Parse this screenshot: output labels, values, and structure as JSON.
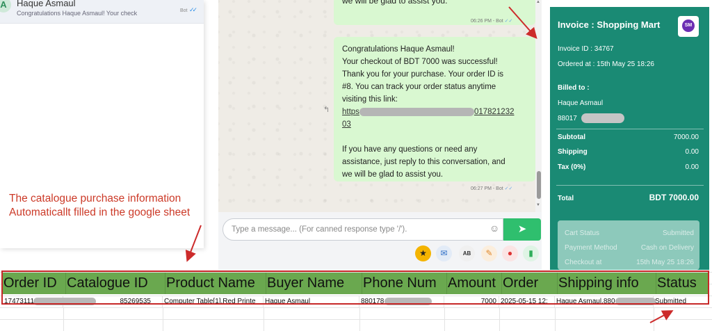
{
  "contact_list": {
    "avatar_initial": "A",
    "name": "Haque Asmaul",
    "preview": "Congratulations Haque Asmaul! Your check",
    "tag": "Bot",
    "ticks": "✓✓"
  },
  "chat": {
    "top_bubble_text": "we will be glad to assist you.",
    "top_bubble_time": "06:26 PM - Bot",
    "main_bubble": {
      "line1": "Congratulations Haque Asmaul!",
      "line2": "Your checkout of BDT 7000 was successful!",
      "line3": "Thank you for your purchase. Your order ID is",
      "line4": "#8. You can track your order status anytime",
      "line5": "visiting this link:",
      "link_start": "https",
      "link_end": "017821232",
      "link_wrap": "03",
      "line6": "If you have any questions or need any",
      "line7": "assistance, just reply to this conversation, and",
      "line8": "we will be glad to assist you."
    },
    "main_bubble_time": "06:27 PM - Bot",
    "composer_placeholder": "Type a message... (For canned response type '/').",
    "toolbar_icons": [
      "star-icon",
      "inbox-icon",
      "spellcheck-icon",
      "attachment-icon",
      "location-icon",
      "microphone-icon"
    ]
  },
  "invoice": {
    "title": "Invoice : Shopping Mart",
    "invoice_id": "Invoice ID : 34767",
    "ordered_at": "Ordered at : 15th May 25 18:26",
    "billed_to_label": "Billed to :",
    "billed_name": "Haque Asmaul",
    "billed_phone": "88017",
    "subtotal_label": "Subtotal",
    "subtotal_value": "7000.00",
    "shipping_label": "Shipping",
    "shipping_value": "0.00",
    "tax_label": "Tax (0%)",
    "tax_value": "0.00",
    "total_label": "Total",
    "total_value": "BDT 7000.00",
    "card_rows": [
      {
        "label": "Cart Status",
        "value": "Submitted"
      },
      {
        "label": "Payment Method",
        "value": "Cash on Delivery"
      },
      {
        "label": "Checkout at",
        "value": "15th May 25 18:26"
      }
    ],
    "accent_color": "#1a8a74"
  },
  "annotation": {
    "line1": "The catalogue purchase information",
    "line2": "Automaticallt filled in the google sheet",
    "color": "#cc3a28"
  },
  "sheet": {
    "headers": [
      "Order ID",
      "Catalogue ID",
      "Product Name",
      "Buyer Name",
      "Phone Num",
      "Amount",
      "Order",
      "Shipping info",
      "Status"
    ],
    "row": {
      "order_id": "17473111",
      "catalogue_id": "85269535",
      "product_name": "Computer Table[1],Red Printe",
      "buyer_name": "Haque Asmaul",
      "phone": "880178",
      "amount": "7000",
      "order": "2025-05-15 12:",
      "shipping": "Haque Asmaul,880",
      "status": "Submitted"
    },
    "header_color": "#6aa84f"
  }
}
